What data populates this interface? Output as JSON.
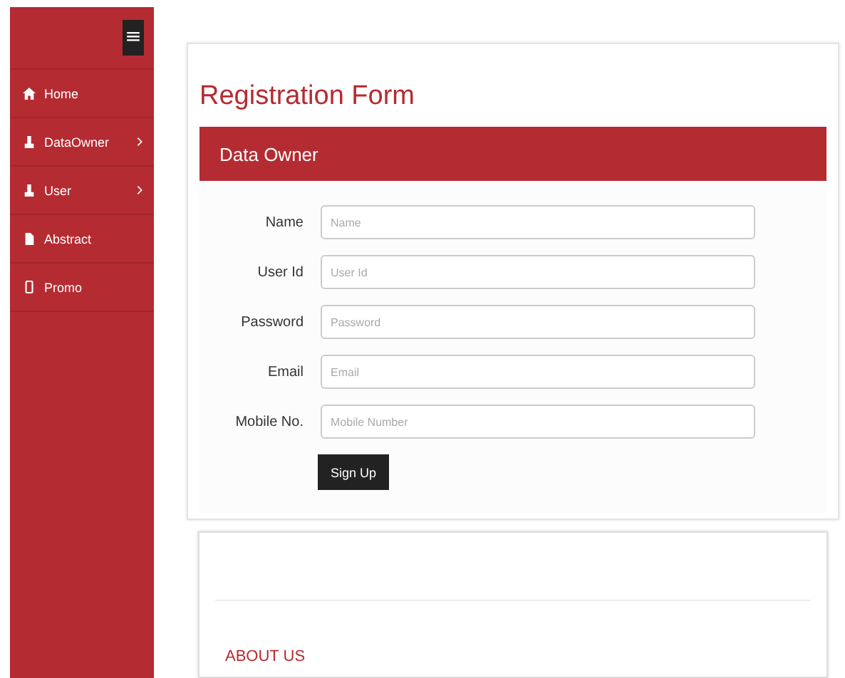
{
  "sidebar": {
    "menu_button": "≡",
    "items": [
      {
        "kind": "home",
        "label": "Home",
        "submenu": false
      },
      {
        "kind": "person",
        "label": "DataOwner",
        "submenu": true
      },
      {
        "kind": "person",
        "label": "User",
        "submenu": true
      },
      {
        "kind": "document",
        "label": "Abstract",
        "submenu": false
      },
      {
        "kind": "phone",
        "label": "Promo",
        "submenu": false
      }
    ]
  },
  "form": {
    "title": "Registration Form",
    "header": "Data Owner",
    "fields": [
      {
        "label": "Name",
        "placeholder": "Name"
      },
      {
        "label": "User Id",
        "placeholder": "User Id"
      },
      {
        "label": "Password",
        "placeholder": "Password"
      },
      {
        "label": "Email",
        "placeholder": "Email"
      },
      {
        "label": "Mobile No.",
        "placeholder": "Mobile Number"
      }
    ],
    "submit": "Sign Up"
  },
  "about": {
    "heading": "ABOUT US"
  }
}
